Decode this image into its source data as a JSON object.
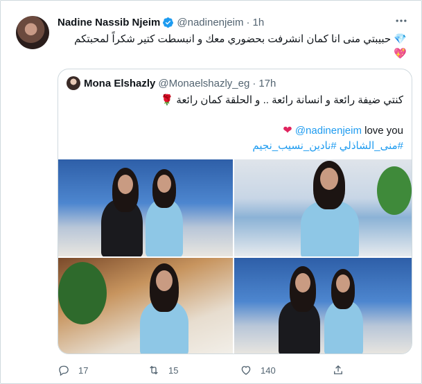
{
  "tweet": {
    "author_name": "Nadine Nassib Njeim",
    "handle": "@nadinenjeim",
    "separator": "·",
    "time": "1h",
    "text": "حبيبتي منى انا كمان انشرفت بحضوري معك و انبسطت كتير شكراً لمحبتكم",
    "emoji_gem": "💎",
    "emoji_heart": "💖"
  },
  "quoted": {
    "author_name": "Mona Elshazly",
    "handle": "@Monaelshazly_eg",
    "separator": "·",
    "time": "17h",
    "line1": "كنتي ضيفة رائعة و انسانة رائعة .. و الحلقة كمان رائعة",
    "emoji_rose": "🌹",
    "mention": "@nadinenjeim",
    "line2_rest": " love you",
    "heart": "❤",
    "hashtags": "#منى_الشاذلي #نادين_نسيب_نجيم"
  },
  "actions": {
    "reply_count": "17",
    "retweet_count": "15",
    "like_count": "140",
    "share_count": ""
  },
  "colors": {
    "accent": "#1d9bf0",
    "text": "#0f1419",
    "muted": "#536471",
    "border": "#cfd9de",
    "like": "#e0245e"
  },
  "icons": [
    "verified-badge-icon",
    "more-icon",
    "reply-icon",
    "retweet-icon",
    "like-icon",
    "share-icon"
  ]
}
